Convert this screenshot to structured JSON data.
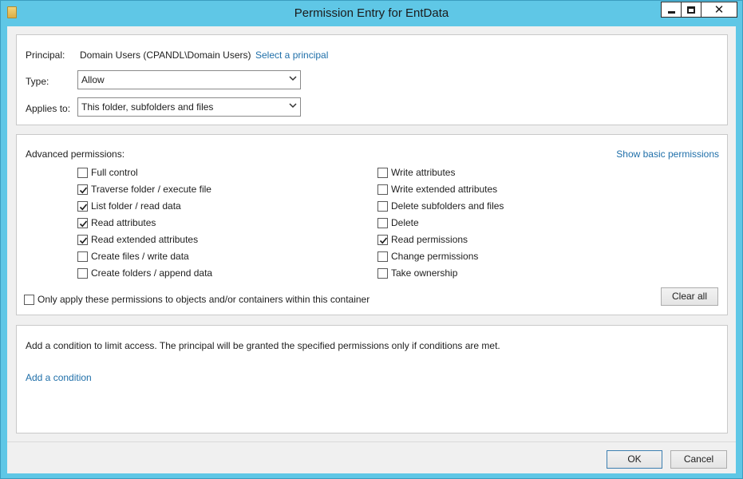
{
  "window": {
    "title": "Permission Entry for EntData"
  },
  "top": {
    "principal_label": "Principal:",
    "principal_value": "Domain Users (CPANDL\\Domain Users)",
    "select_principal_link": "Select a principal",
    "type_label": "Type:",
    "type_value": "Allow",
    "applies_label": "Applies to:",
    "applies_value": "This folder, subfolders and files"
  },
  "permissions": {
    "heading": "Advanced permissions:",
    "show_basic_link": "Show basic permissions",
    "left": [
      {
        "label": "Full control",
        "checked": false
      },
      {
        "label": "Traverse folder / execute file",
        "checked": true
      },
      {
        "label": "List folder / read data",
        "checked": true
      },
      {
        "label": "Read attributes",
        "checked": true
      },
      {
        "label": "Read extended attributes",
        "checked": true
      },
      {
        "label": "Create files / write data",
        "checked": false
      },
      {
        "label": "Create folders / append data",
        "checked": false
      }
    ],
    "right": [
      {
        "label": "Write attributes",
        "checked": false
      },
      {
        "label": "Write extended attributes",
        "checked": false
      },
      {
        "label": "Delete subfolders and files",
        "checked": false
      },
      {
        "label": "Delete",
        "checked": false
      },
      {
        "label": "Read permissions",
        "checked": true
      },
      {
        "label": "Change permissions",
        "checked": false
      },
      {
        "label": "Take ownership",
        "checked": false
      }
    ],
    "only_apply_label": "Only apply these permissions to objects and/or containers within this container",
    "only_apply_checked": false,
    "clear_all_label": "Clear all"
  },
  "condition": {
    "description": "Add a condition to limit access. The principal will be granted the specified permissions only if conditions are met.",
    "add_link": "Add a condition"
  },
  "footer": {
    "ok_label": "OK",
    "cancel_label": "Cancel"
  }
}
